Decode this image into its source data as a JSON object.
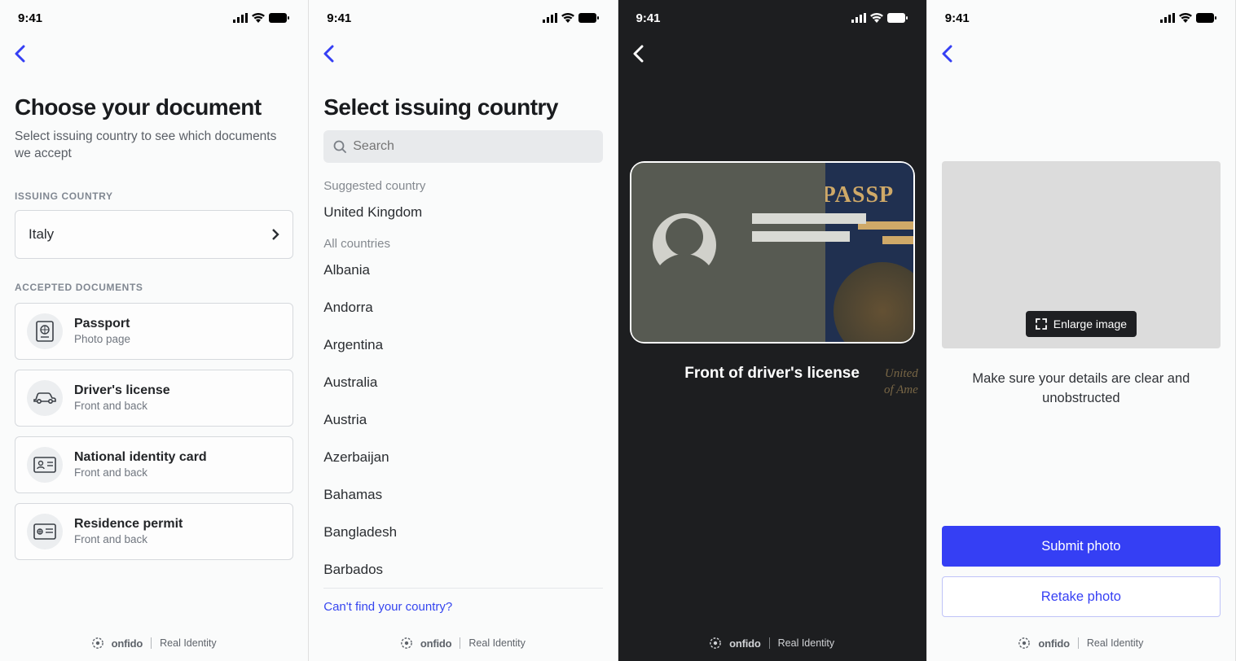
{
  "status": {
    "time": "9:41"
  },
  "screen1": {
    "title": "Choose your document",
    "subtitle": "Select issuing country to see which documents we accept",
    "issuing_label": "ISSUING COUNTRY",
    "selected_country": "Italy",
    "accepted_label": "ACCEPTED DOCUMENTS",
    "docs": [
      {
        "title": "Passport",
        "sub": "Photo page"
      },
      {
        "title": "Driver's license",
        "sub": "Front and back"
      },
      {
        "title": "National identity card",
        "sub": "Front and back"
      },
      {
        "title": "Residence permit",
        "sub": "Front and back"
      }
    ]
  },
  "screen2": {
    "title": "Select issuing country",
    "search_placeholder": "Search",
    "suggested_label": "Suggested country",
    "suggested": "United Kingdom",
    "all_label": "All countries",
    "countries": [
      "Albania",
      "Andorra",
      "Argentina",
      "Australia",
      "Austria",
      "Azerbaijan",
      "Bahamas",
      "Bangladesh",
      "Barbados"
    ],
    "cant_find": "Can't find your country?"
  },
  "screen3": {
    "caption": "Front of driver's license",
    "passport_text": "PASSP",
    "passport_sub1": "United",
    "passport_sub2": "of Ame"
  },
  "screen4": {
    "enlarge": "Enlarge image",
    "message": "Make sure your details are clear and unobstructed",
    "submit": "Submit photo",
    "retake": "Retake photo"
  },
  "brand": {
    "name": "onfido",
    "tagline": "Real Identity"
  }
}
